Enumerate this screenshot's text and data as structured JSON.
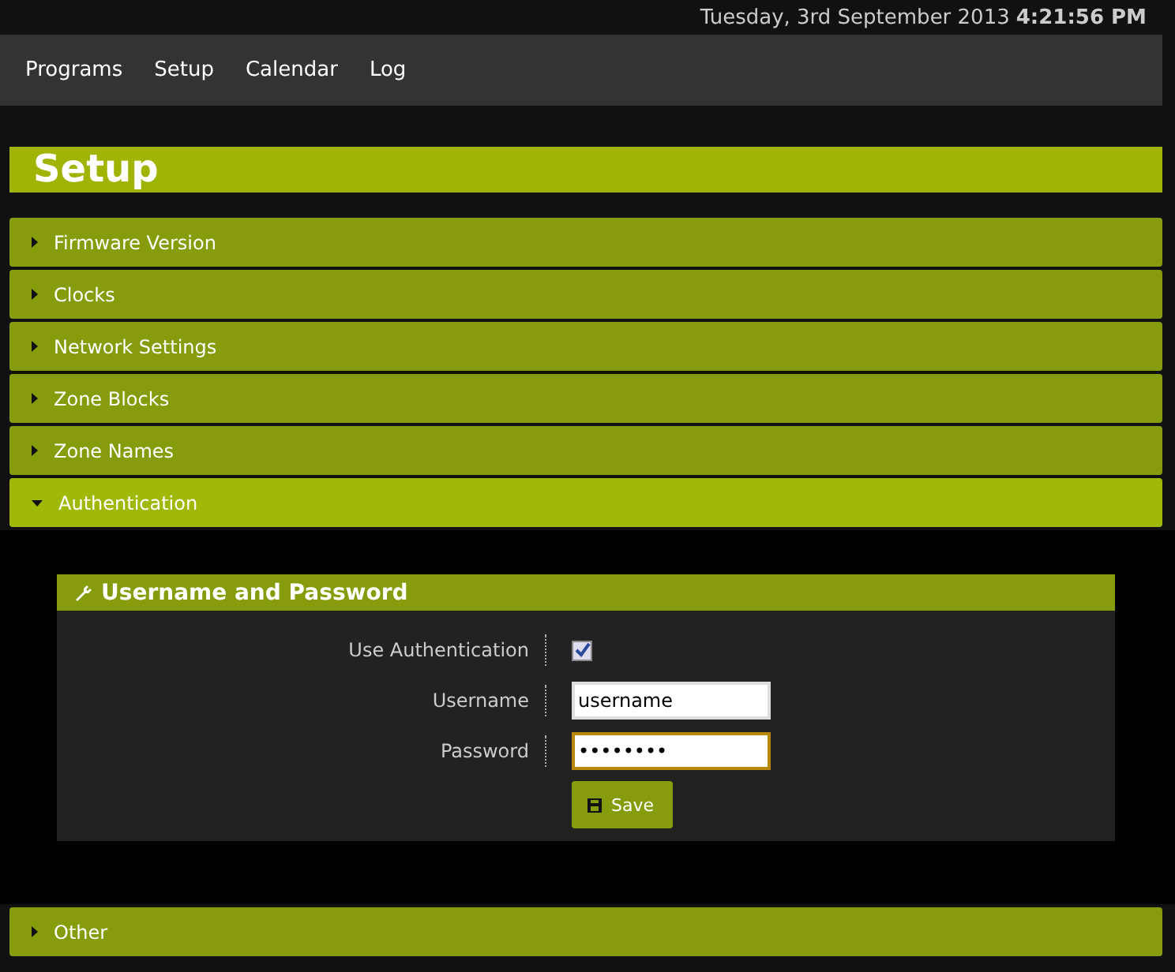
{
  "header": {
    "date": "Tuesday, 3rd September 2013",
    "time": "4:21:56 PM"
  },
  "nav": [
    {
      "label": "Programs"
    },
    {
      "label": "Setup"
    },
    {
      "label": "Calendar"
    },
    {
      "label": "Log"
    }
  ],
  "page_title": "Setup",
  "sections": [
    {
      "label": "Firmware Version",
      "expanded": false
    },
    {
      "label": "Clocks",
      "expanded": false
    },
    {
      "label": "Network Settings",
      "expanded": false
    },
    {
      "label": "Zone Blocks",
      "expanded": false
    },
    {
      "label": "Zone Names",
      "expanded": false
    },
    {
      "label": "Authentication",
      "expanded": true,
      "panel": {
        "title": "Username and Password",
        "fields": [
          {
            "kind": "checkbox",
            "label": "Use Authentication",
            "checked": true
          },
          {
            "kind": "text",
            "label": "Username",
            "value": "username",
            "focused": false
          },
          {
            "kind": "text",
            "label": "Password",
            "value": "••••••••",
            "focused": true
          }
        ],
        "button": "Save"
      }
    },
    {
      "label": "Other",
      "expanded": false
    }
  ]
}
